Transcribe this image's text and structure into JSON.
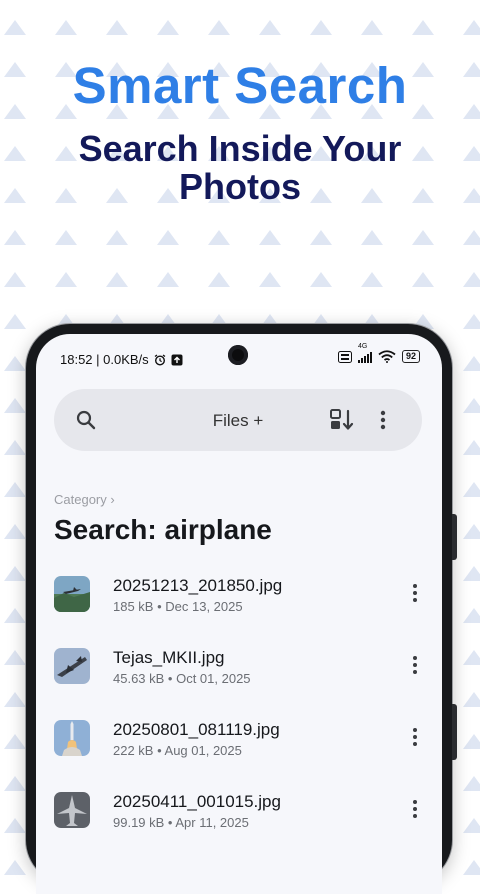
{
  "hero": {
    "title": "Smart Search",
    "subtitle": "Search Inside Your Photos"
  },
  "status_bar": {
    "time_net": "18:52 | 0.0KB/s",
    "signal_label": "4G",
    "battery": "92"
  },
  "app_bar": {
    "title": "Files +"
  },
  "breadcrumb": "Category ›",
  "page_title": "Search: airplane",
  "files": [
    {
      "name": "20251213_201850.jpg",
      "meta": "185 kB • Dec 13, 2025"
    },
    {
      "name": "Tejas_MKII.jpg",
      "meta": "45.63 kB • Oct 01, 2025"
    },
    {
      "name": "20250801_081119.jpg",
      "meta": "222 kB • Aug 01, 2025"
    },
    {
      "name": "20250411_001015.jpg",
      "meta": "99.19 kB • Apr 11, 2025"
    }
  ],
  "icons": {
    "search": "search-icon",
    "sort": "sort-icon",
    "more": "more-vert-icon",
    "alarm": "alarm-icon",
    "upload": "upload-icon",
    "wifi": "wifi-icon",
    "signal": "signal-icon"
  },
  "colors": {
    "hero_title": "#2f7fe6",
    "hero_subtitle": "#13195a",
    "pattern": "#dfe6f3",
    "screen_bg": "#f6f7fb",
    "searchbar_bg": "#e6e7ec"
  }
}
